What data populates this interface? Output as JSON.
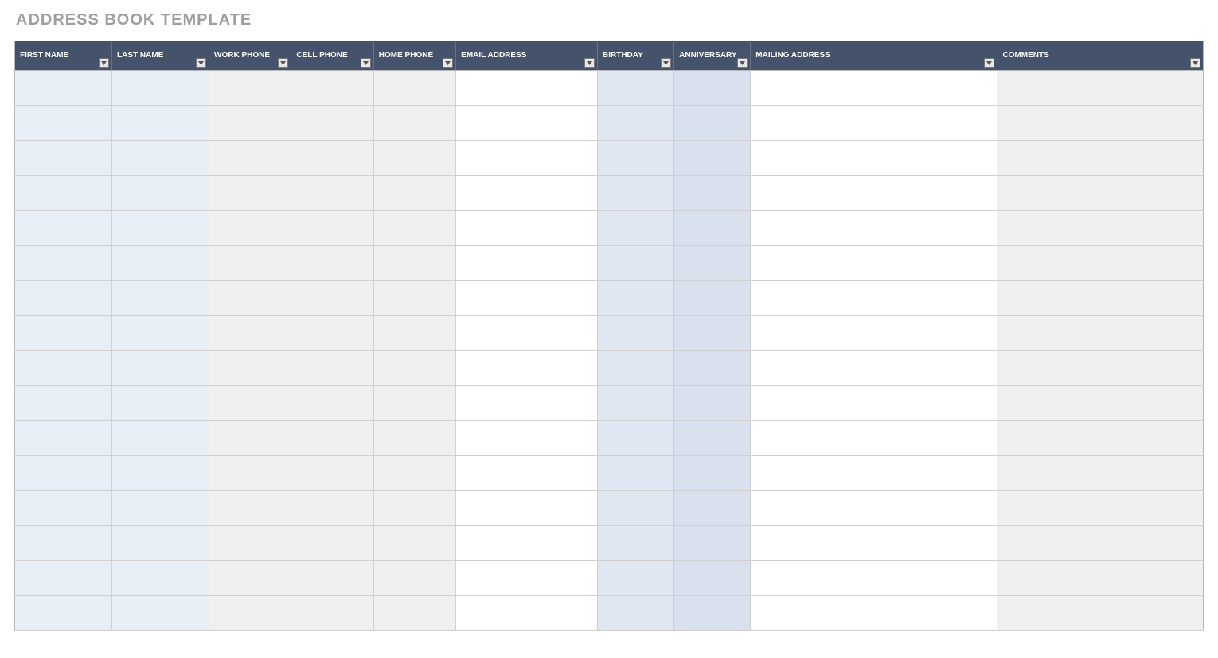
{
  "title": "ADDRESS BOOK TEMPLATE",
  "columns": [
    {
      "key": "first_name",
      "label": "FIRST NAME"
    },
    {
      "key": "last_name",
      "label": "LAST NAME"
    },
    {
      "key": "work_phone",
      "label": "WORK PHONE"
    },
    {
      "key": "cell_phone",
      "label": "CELL PHONE"
    },
    {
      "key": "home_phone",
      "label": "HOME PHONE"
    },
    {
      "key": "email",
      "label": "EMAIL ADDRESS"
    },
    {
      "key": "birthday",
      "label": "BIRTHDAY"
    },
    {
      "key": "anniversary",
      "label": "ANNIVERSARY"
    },
    {
      "key": "mailing",
      "label": "MAILING ADDRESS"
    },
    {
      "key": "comments",
      "label": "COMMENTS"
    }
  ],
  "row_count": 32,
  "rows": [
    {
      "first_name": "",
      "last_name": "",
      "work_phone": "",
      "cell_phone": "",
      "home_phone": "",
      "email": "",
      "birthday": "",
      "anniversary": "",
      "mailing": "",
      "comments": ""
    },
    {
      "first_name": "",
      "last_name": "",
      "work_phone": "",
      "cell_phone": "",
      "home_phone": "",
      "email": "",
      "birthday": "",
      "anniversary": "",
      "mailing": "",
      "comments": ""
    },
    {
      "first_name": "",
      "last_name": "",
      "work_phone": "",
      "cell_phone": "",
      "home_phone": "",
      "email": "",
      "birthday": "",
      "anniversary": "",
      "mailing": "",
      "comments": ""
    },
    {
      "first_name": "",
      "last_name": "",
      "work_phone": "",
      "cell_phone": "",
      "home_phone": "",
      "email": "",
      "birthday": "",
      "anniversary": "",
      "mailing": "",
      "comments": ""
    },
    {
      "first_name": "",
      "last_name": "",
      "work_phone": "",
      "cell_phone": "",
      "home_phone": "",
      "email": "",
      "birthday": "",
      "anniversary": "",
      "mailing": "",
      "comments": ""
    },
    {
      "first_name": "",
      "last_name": "",
      "work_phone": "",
      "cell_phone": "",
      "home_phone": "",
      "email": "",
      "birthday": "",
      "anniversary": "",
      "mailing": "",
      "comments": ""
    },
    {
      "first_name": "",
      "last_name": "",
      "work_phone": "",
      "cell_phone": "",
      "home_phone": "",
      "email": "",
      "birthday": "",
      "anniversary": "",
      "mailing": "",
      "comments": ""
    },
    {
      "first_name": "",
      "last_name": "",
      "work_phone": "",
      "cell_phone": "",
      "home_phone": "",
      "email": "",
      "birthday": "",
      "anniversary": "",
      "mailing": "",
      "comments": ""
    },
    {
      "first_name": "",
      "last_name": "",
      "work_phone": "",
      "cell_phone": "",
      "home_phone": "",
      "email": "",
      "birthday": "",
      "anniversary": "",
      "mailing": "",
      "comments": ""
    },
    {
      "first_name": "",
      "last_name": "",
      "work_phone": "",
      "cell_phone": "",
      "home_phone": "",
      "email": "",
      "birthday": "",
      "anniversary": "",
      "mailing": "",
      "comments": ""
    },
    {
      "first_name": "",
      "last_name": "",
      "work_phone": "",
      "cell_phone": "",
      "home_phone": "",
      "email": "",
      "birthday": "",
      "anniversary": "",
      "mailing": "",
      "comments": ""
    },
    {
      "first_name": "",
      "last_name": "",
      "work_phone": "",
      "cell_phone": "",
      "home_phone": "",
      "email": "",
      "birthday": "",
      "anniversary": "",
      "mailing": "",
      "comments": ""
    },
    {
      "first_name": "",
      "last_name": "",
      "work_phone": "",
      "cell_phone": "",
      "home_phone": "",
      "email": "",
      "birthday": "",
      "anniversary": "",
      "mailing": "",
      "comments": ""
    },
    {
      "first_name": "",
      "last_name": "",
      "work_phone": "",
      "cell_phone": "",
      "home_phone": "",
      "email": "",
      "birthday": "",
      "anniversary": "",
      "mailing": "",
      "comments": ""
    },
    {
      "first_name": "",
      "last_name": "",
      "work_phone": "",
      "cell_phone": "",
      "home_phone": "",
      "email": "",
      "birthday": "",
      "anniversary": "",
      "mailing": "",
      "comments": ""
    },
    {
      "first_name": "",
      "last_name": "",
      "work_phone": "",
      "cell_phone": "",
      "home_phone": "",
      "email": "",
      "birthday": "",
      "anniversary": "",
      "mailing": "",
      "comments": ""
    },
    {
      "first_name": "",
      "last_name": "",
      "work_phone": "",
      "cell_phone": "",
      "home_phone": "",
      "email": "",
      "birthday": "",
      "anniversary": "",
      "mailing": "",
      "comments": ""
    },
    {
      "first_name": "",
      "last_name": "",
      "work_phone": "",
      "cell_phone": "",
      "home_phone": "",
      "email": "",
      "birthday": "",
      "anniversary": "",
      "mailing": "",
      "comments": ""
    },
    {
      "first_name": "",
      "last_name": "",
      "work_phone": "",
      "cell_phone": "",
      "home_phone": "",
      "email": "",
      "birthday": "",
      "anniversary": "",
      "mailing": "",
      "comments": ""
    },
    {
      "first_name": "",
      "last_name": "",
      "work_phone": "",
      "cell_phone": "",
      "home_phone": "",
      "email": "",
      "birthday": "",
      "anniversary": "",
      "mailing": "",
      "comments": ""
    },
    {
      "first_name": "",
      "last_name": "",
      "work_phone": "",
      "cell_phone": "",
      "home_phone": "",
      "email": "",
      "birthday": "",
      "anniversary": "",
      "mailing": "",
      "comments": ""
    },
    {
      "first_name": "",
      "last_name": "",
      "work_phone": "",
      "cell_phone": "",
      "home_phone": "",
      "email": "",
      "birthday": "",
      "anniversary": "",
      "mailing": "",
      "comments": ""
    },
    {
      "first_name": "",
      "last_name": "",
      "work_phone": "",
      "cell_phone": "",
      "home_phone": "",
      "email": "",
      "birthday": "",
      "anniversary": "",
      "mailing": "",
      "comments": ""
    },
    {
      "first_name": "",
      "last_name": "",
      "work_phone": "",
      "cell_phone": "",
      "home_phone": "",
      "email": "",
      "birthday": "",
      "anniversary": "",
      "mailing": "",
      "comments": ""
    },
    {
      "first_name": "",
      "last_name": "",
      "work_phone": "",
      "cell_phone": "",
      "home_phone": "",
      "email": "",
      "birthday": "",
      "anniversary": "",
      "mailing": "",
      "comments": ""
    },
    {
      "first_name": "",
      "last_name": "",
      "work_phone": "",
      "cell_phone": "",
      "home_phone": "",
      "email": "",
      "birthday": "",
      "anniversary": "",
      "mailing": "",
      "comments": ""
    },
    {
      "first_name": "",
      "last_name": "",
      "work_phone": "",
      "cell_phone": "",
      "home_phone": "",
      "email": "",
      "birthday": "",
      "anniversary": "",
      "mailing": "",
      "comments": ""
    },
    {
      "first_name": "",
      "last_name": "",
      "work_phone": "",
      "cell_phone": "",
      "home_phone": "",
      "email": "",
      "birthday": "",
      "anniversary": "",
      "mailing": "",
      "comments": ""
    },
    {
      "first_name": "",
      "last_name": "",
      "work_phone": "",
      "cell_phone": "",
      "home_phone": "",
      "email": "",
      "birthday": "",
      "anniversary": "",
      "mailing": "",
      "comments": ""
    },
    {
      "first_name": "",
      "last_name": "",
      "work_phone": "",
      "cell_phone": "",
      "home_phone": "",
      "email": "",
      "birthday": "",
      "anniversary": "",
      "mailing": "",
      "comments": ""
    },
    {
      "first_name": "",
      "last_name": "",
      "work_phone": "",
      "cell_phone": "",
      "home_phone": "",
      "email": "",
      "birthday": "",
      "anniversary": "",
      "mailing": "",
      "comments": ""
    },
    {
      "first_name": "",
      "last_name": "",
      "work_phone": "",
      "cell_phone": "",
      "home_phone": "",
      "email": "",
      "birthday": "",
      "anniversary": "",
      "mailing": "",
      "comments": ""
    }
  ]
}
